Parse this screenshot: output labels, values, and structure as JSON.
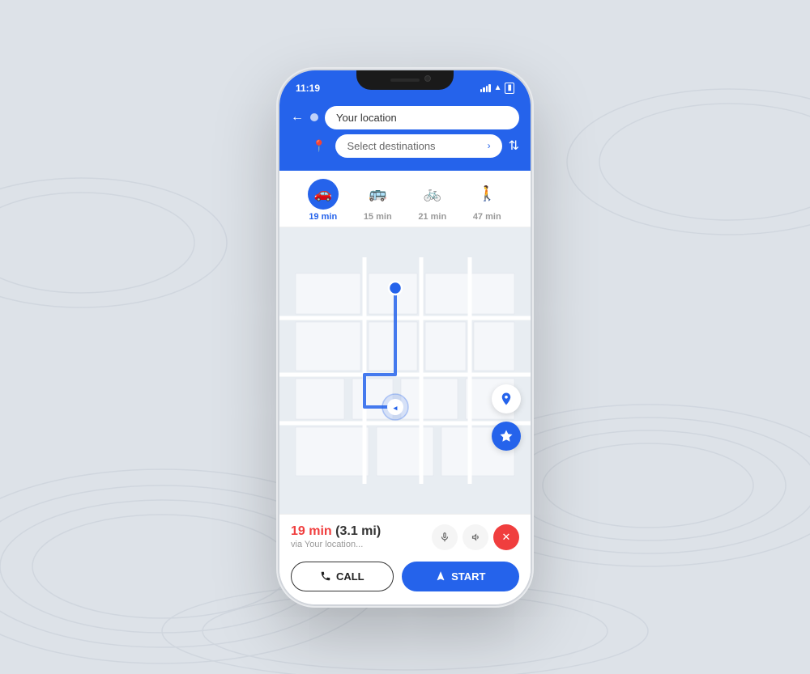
{
  "background": {
    "color": "#e8ecf0"
  },
  "status_bar": {
    "time": "11:19",
    "signal": "full",
    "wifi": "on",
    "battery": "full"
  },
  "navigation": {
    "back_label": "←",
    "your_location_placeholder": "Your location",
    "destination_placeholder": "Select destinations",
    "swap_label": "⇅"
  },
  "transport_modes": [
    {
      "icon": "🚗",
      "time": "19 min",
      "active": true
    },
    {
      "icon": "🚌",
      "time": "15 min",
      "active": false
    },
    {
      "icon": "🚲",
      "time": "21 min",
      "active": false
    },
    {
      "icon": "🚶",
      "time": "47 min",
      "active": false
    }
  ],
  "map": {
    "location_btn_icon": "◂",
    "diamond_btn_icon": "◈",
    "nav_arrow_icon": "◂"
  },
  "trip": {
    "time": "19 min",
    "distance": "(3.1 mi)",
    "via": "via Your location...",
    "mic_icon": "🎤",
    "volume_icon": "🔊",
    "close_icon": "✕"
  },
  "actions": {
    "call_label": "CALL",
    "call_icon": "📞",
    "start_label": "START",
    "start_icon": "▲"
  }
}
